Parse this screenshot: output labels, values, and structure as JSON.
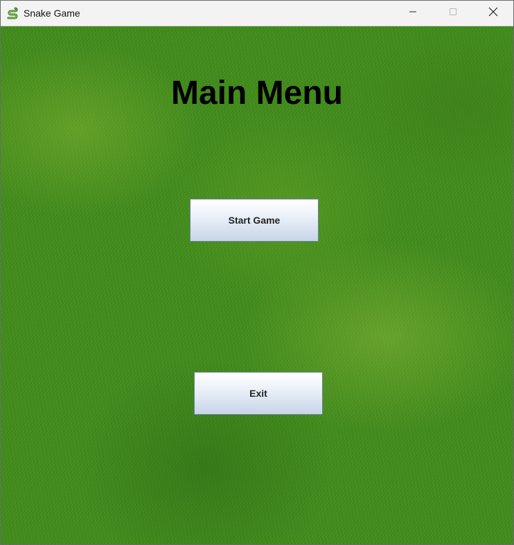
{
  "window": {
    "title": "Snake Game",
    "icon": "snake-icon",
    "controls": [
      "minimize-icon",
      "maximize-icon",
      "close-icon"
    ]
  },
  "menu": {
    "title": "Main Menu",
    "start_label": "Start Game",
    "exit_label": "Exit"
  },
  "colors": {
    "title_bar": "#f3f3f3",
    "grass": "#3f8a1a",
    "button_top": "#ffffff",
    "button_bottom": "#c7d5e8",
    "button_border": "#6d7f98",
    "title_text": "#000000"
  }
}
